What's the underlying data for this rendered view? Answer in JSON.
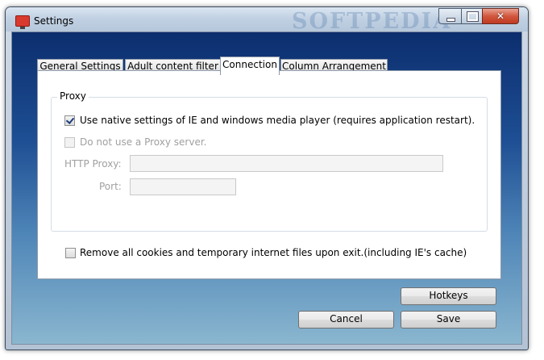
{
  "window": {
    "title": "Settings",
    "watermark": "SOFTPEDIA",
    "controls": {
      "minimize": "minimize",
      "maximize": "maximize",
      "close": "✕"
    }
  },
  "tabs": [
    {
      "label": "General Settings",
      "active": false
    },
    {
      "label": "Adult content filter",
      "active": false
    },
    {
      "label": "Connection",
      "active": true
    },
    {
      "label": "Column Arrangement",
      "active": false
    }
  ],
  "proxy": {
    "group_label": "Proxy",
    "use_native_label": "Use native settings of IE and windows media player (requires application restart).",
    "use_native_checked": true,
    "no_proxy_label": "Do not use a Proxy server.",
    "no_proxy_checked": false,
    "http_proxy_label": "HTTP Proxy:",
    "http_proxy_value": "",
    "port_label": "Port:",
    "port_value": ""
  },
  "cookies": {
    "label": "Remove all cookies and temporary internet files upon exit.(including IE's cache)",
    "checked": false
  },
  "buttons": {
    "hotkeys": "Hotkeys",
    "cancel": "Cancel",
    "save": "Save"
  },
  "colors": {
    "accent_check": "#1a3a7a",
    "close_button": "#c03a22"
  }
}
